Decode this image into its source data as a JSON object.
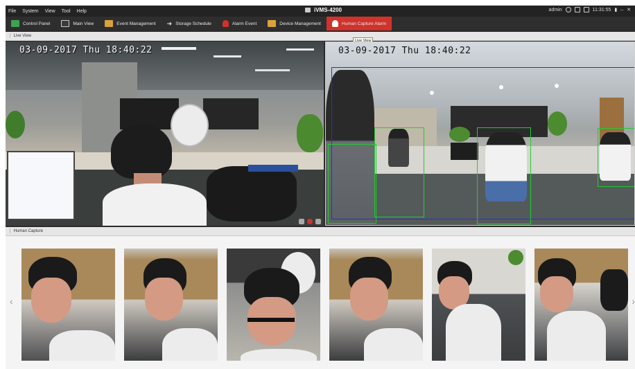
{
  "menubar": {
    "menus": [
      "File",
      "System",
      "View",
      "Tool",
      "Help"
    ],
    "app_title": "iVMS-4200",
    "user": "admin",
    "time": "11:31:55"
  },
  "toolbar": {
    "tabs": [
      {
        "label": "Control Panel",
        "icon": "grid-icon",
        "color": "#3fa34d"
      },
      {
        "label": "Main View",
        "icon": "monitor-icon",
        "color": "#5a8ac6"
      },
      {
        "label": "Event Management",
        "icon": "folder-icon",
        "color": "#d9a23c"
      },
      {
        "label": "Storage Schedule",
        "icon": "arrow-icon",
        "color": "#cfcfcf"
      },
      {
        "label": "Alarm Event",
        "icon": "alarm-icon",
        "color": "#d0322c"
      },
      {
        "label": "Device Management",
        "icon": "device-icon",
        "color": "#d9a23c"
      },
      {
        "label": "Human Capture Alarm",
        "icon": "alarm-icon",
        "color": "#ffffff"
      }
    ],
    "active_index": 6
  },
  "live_view": {
    "header": "Live View",
    "tooltip": "Live View",
    "left_osd": "03-09-2017 Thu 18:40:22",
    "right_osd": "03-09-2017 Thu 18:40:22"
  },
  "human_capture": {
    "header": "Human Capture",
    "prev_arrow": "‹",
    "next_arrow": "›",
    "thumbnails": 6
  },
  "colors": {
    "accent": "#d0322c",
    "detection_box": "#22cc33",
    "rule_box": "#2233cc"
  }
}
